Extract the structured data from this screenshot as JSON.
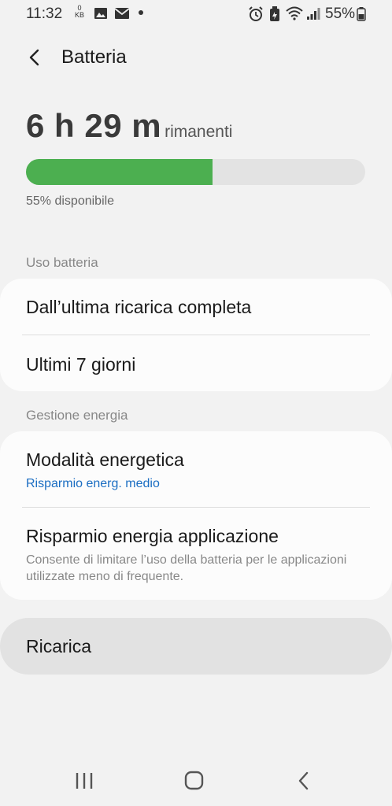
{
  "status_bar": {
    "time": "11:32",
    "data_counter": "0",
    "data_unit": "KB",
    "battery_percent": "55%",
    "icons": [
      "image-icon",
      "mail-icon",
      "notification-dot-icon",
      "alarm-icon",
      "battery-saver-icon",
      "wifi-icon",
      "signal-icon",
      "battery-icon"
    ]
  },
  "header": {
    "title": "Batteria",
    "back_icon": "chevron-left-icon"
  },
  "battery": {
    "time_remaining": "6 h 29 m",
    "remaining_label": "rimanenti",
    "level_percent": 55,
    "available_text": "55% disponibile",
    "fill_color": "#4caf50"
  },
  "usage_section": {
    "title": "Uso batteria",
    "items": [
      {
        "label": "Dall’ultima ricarica completa"
      },
      {
        "label": "Ultimi 7 giorni"
      }
    ]
  },
  "power_section": {
    "title": "Gestione energia",
    "items": [
      {
        "label": "Modalità energetica",
        "value": "Risparmio energ. medio"
      },
      {
        "label": "Risparmio energia applicazione",
        "description": "Consente di limitare l’uso della batteria per le applicazioni utilizzate meno di frequente."
      }
    ]
  },
  "charging": {
    "label": "Ricarica"
  },
  "nav_bar": {
    "icons": [
      "recent-apps-icon",
      "home-icon",
      "back-icon"
    ]
  },
  "colors": {
    "accent_blue": "#1a6dc2",
    "battery_green": "#4caf50"
  }
}
